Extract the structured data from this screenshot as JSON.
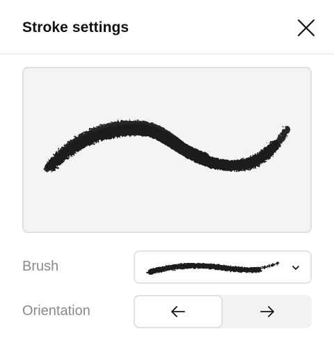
{
  "dialog": {
    "title": "Stroke settings"
  },
  "fields": {
    "brush_label": "Brush",
    "orientation_label": "Orientation"
  },
  "icons": {
    "close": "close-icon",
    "dropdown": "chevron-down-icon",
    "orientation_left": "arrow-left-icon",
    "orientation_right": "arrow-right-icon"
  },
  "orientation": {
    "selected": "left"
  },
  "colors": {
    "stroke": "#1a1a1a",
    "preview_bg": "#f4f4f4",
    "label_text": "#8a8a8a"
  }
}
